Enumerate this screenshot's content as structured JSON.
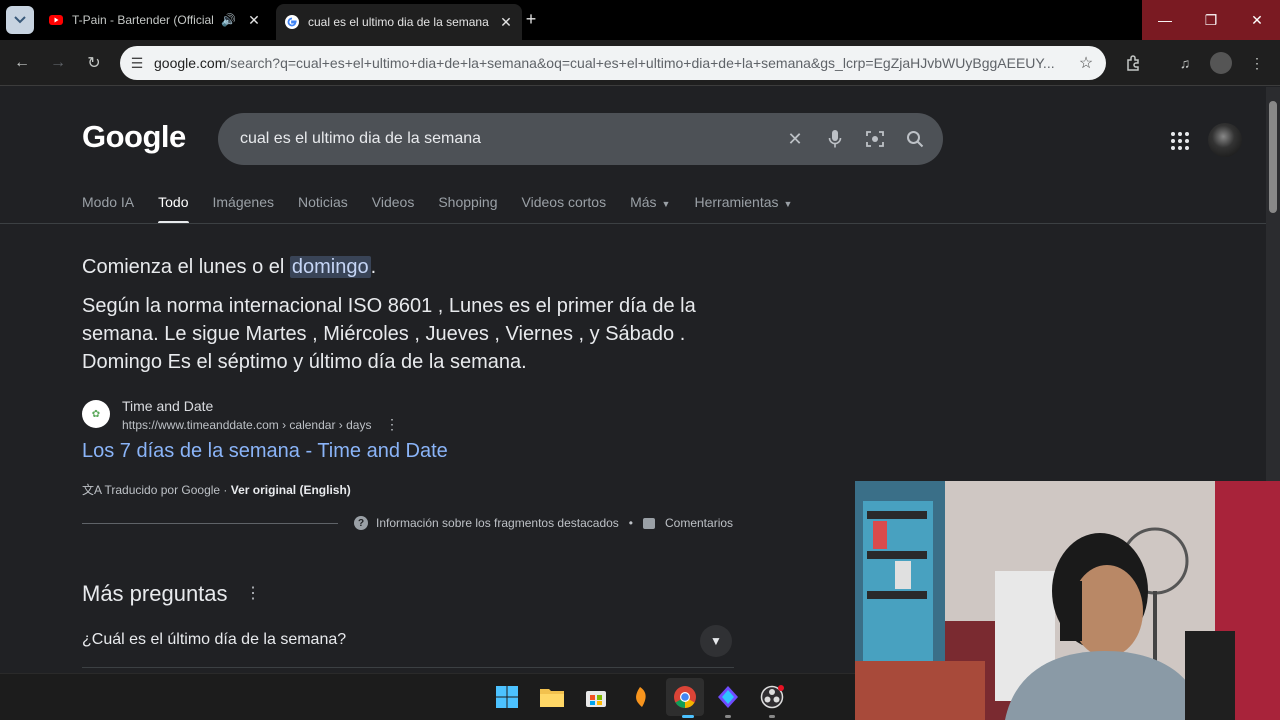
{
  "browser": {
    "tabs": [
      {
        "title": "T-Pain - Bartender (Official",
        "playing_audio": true
      },
      {
        "title": "cual es el ultimo dia de la semana",
        "active": true
      }
    ],
    "new_tab_label": "+",
    "url_host": "google.com",
    "url_rest": "/search?q=cual+es+el+ultimo+dia+de+la+semana&oq=cual+es+el+ultimo+dia+de+la+semana&gs_lcrp=EgZjaHJvbWUyBggAEEUY..."
  },
  "google": {
    "logo": "Google",
    "query": "cual es el ultimo dia de la semana",
    "tabs": [
      {
        "label": "Modo IA"
      },
      {
        "label": "Todo",
        "active": true
      },
      {
        "label": "Imágenes"
      },
      {
        "label": "Noticias"
      },
      {
        "label": "Videos"
      },
      {
        "label": "Shopping"
      },
      {
        "label": "Videos cortos"
      },
      {
        "label": "Más",
        "dropdown": true
      },
      {
        "label": "Herramientas",
        "dropdown": true
      }
    ]
  },
  "snippet": {
    "headline_prefix": "Comienza el lunes o el ",
    "headline_highlight": "domingo",
    "headline_suffix": ".",
    "answer": "Según la norma internacional ISO 8601 , Lunes es el primer día de la semana. Le sigue Martes , Miércoles , Jueves , Viernes , y Sábado . Domingo Es el séptimo y último día de la semana.",
    "source_name": "Time and Date",
    "source_url": "https://www.timeanddate.com › calendar › days",
    "result_title": "Los 7 días de la semana - Time and Date",
    "translated_by": "Traducido por Google",
    "view_original": "Ver original (English)",
    "info_label": "Información sobre los fragmentos destacados",
    "feedback_label": "Comentarios"
  },
  "more_questions": {
    "heading": "Más preguntas",
    "items": [
      "¿Cuál es el último día de la semana?"
    ]
  },
  "colors": {
    "link": "#8ab4f8",
    "page_bg": "#202124",
    "search_bg": "#4d5156",
    "highlight_bg": "#394457"
  }
}
